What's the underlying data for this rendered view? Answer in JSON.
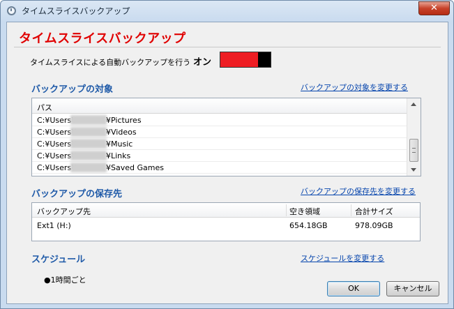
{
  "window": {
    "title": "タイムスライスバックアップ",
    "close_label": "✕"
  },
  "heading": "タイムスライスバックアップ",
  "auto_backup": {
    "label": "タイムスライスによる自動バックアップを行う",
    "state": "オン",
    "on_color": "#ee1d23"
  },
  "targets": {
    "title": "バックアップの対象",
    "change_link": "バックアップの対象を変更する",
    "column": "パス",
    "rows": [
      {
        "prefix": "C:¥Users¥",
        "suffix": "¥Pictures"
      },
      {
        "prefix": "C:¥Users¥",
        "suffix": "¥Videos"
      },
      {
        "prefix": "C:¥Users¥",
        "suffix": "¥Music"
      },
      {
        "prefix": "C:¥Users¥",
        "suffix": "¥Links"
      },
      {
        "prefix": "C:¥Users¥",
        "suffix": "¥Saved Games"
      }
    ]
  },
  "destination": {
    "title": "バックアップの保存先",
    "change_link": "バックアップの保存先を変更する",
    "columns": [
      "バックアップ先",
      "空き領域",
      "合計サイズ"
    ],
    "rows": [
      {
        "name": "Ext1 (H:)",
        "free": "654.18GB",
        "total": "978.09GB"
      }
    ]
  },
  "schedule": {
    "title": "スケジュール",
    "change_link": "スケジュールを変更する",
    "item": "●1時間ごと"
  },
  "buttons": {
    "ok": "OK",
    "cancel": "キャンセル"
  }
}
